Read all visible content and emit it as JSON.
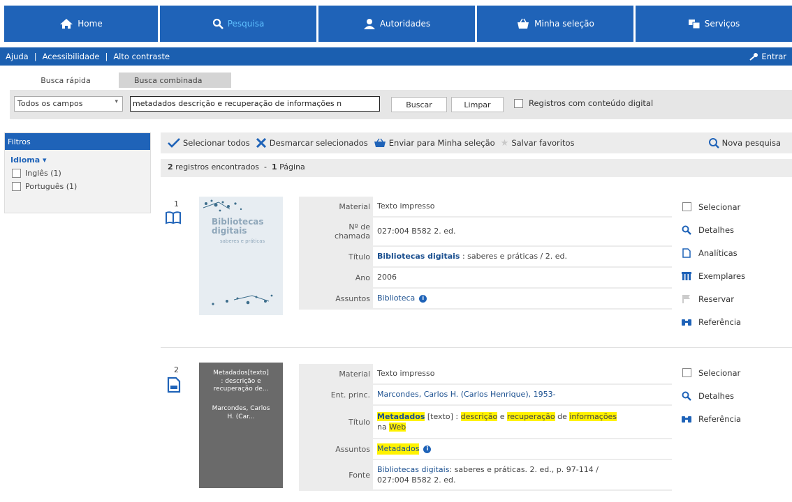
{
  "nav": {
    "home": "Home",
    "pesquisa": "Pesquisa",
    "autoridades": "Autoridades",
    "minha_selecao": "Minha seleção",
    "servicos": "Serviços"
  },
  "subnav": {
    "ajuda": "Ajuda",
    "acessibilidade": "Acessibilidade",
    "alto_contraste": "Alto contraste",
    "entrar": "Entrar"
  },
  "search": {
    "tab_rapida": "Busca rápida",
    "tab_combinada": "Busca combinada",
    "field_select": "Todos os campos",
    "query": "metadados descrição e recuperação de informações n",
    "buscar": "Buscar",
    "limpar": "Limpar",
    "digital_label": "Registros com conteúdo digital"
  },
  "filters": {
    "title": "Filtros",
    "group": "Idioma",
    "options": [
      "Inglês (1)",
      "Português (1)"
    ]
  },
  "toolbar": {
    "select_all": "Selecionar todos",
    "deselect": "Desmarcar selecionados",
    "send": "Enviar para Minha seleção",
    "save_fav": "Salvar favoritos",
    "new_search": "Nova pesquisa"
  },
  "results": {
    "count": "2",
    "count_text": " registros encontrados  -  ",
    "pages": "1",
    "pages_text": " Página"
  },
  "records": [
    {
      "num": "1",
      "material_label": "Material",
      "material": "Texto impresso",
      "chamada_label1": "Nº de",
      "chamada_label2": "chamada",
      "chamada": "027:004 B582 2. ed.",
      "titulo_label": "Título",
      "titulo_bold": "Bibliotecas digitais",
      "titulo_rest": " : saberes e práticas / 2. ed.",
      "ano_label": "Ano",
      "ano": "2006",
      "assuntos_label": "Assuntos",
      "assuntos": "Biblioteca",
      "cover_title": "Bibliotecas digitais",
      "cover_sub": "saberes e práticas",
      "actions": [
        "Selecionar",
        "Detalhes",
        "Analíticas",
        "Exemplares",
        "Reservar",
        "Referência"
      ]
    },
    {
      "num": "2",
      "material_label": "Material",
      "material": "Texto impresso",
      "ent_label": "Ent. princ.",
      "ent": "Marcondes, Carlos H. (Carlos Henrique), 1953-",
      "titulo_label": "Título",
      "t_metadados": "Metadados",
      "t_texto": " [texto] : ",
      "t_descricao": "descrição",
      "t_e": " e ",
      "t_recuperacao": "recuperação",
      "t_de": " de ",
      "t_informacoes": "informações",
      "t_na": "na ",
      "t_web": "Web",
      "assuntos_label": "Assuntos",
      "assuntos": "Metadados",
      "fonte_label": "Fonte",
      "fonte_link": "Bibliotecas digitais",
      "fonte_rest": ": saberes e práticas. 2. ed., p. 97-114 /",
      "fonte_line2": "027:004 B582 2. ed.",
      "cover_line1": "Metadados[texto]",
      "cover_line2": ": descrição e",
      "cover_line3": "recuperação de...",
      "cover_line4": "Marcondes, Carlos",
      "cover_line5": "H. (Car...",
      "actions": [
        "Selecionar",
        "Detalhes",
        "Referência"
      ]
    }
  ],
  "colors": {
    "primary": "#1f63b8",
    "highlight": "#fff200",
    "panel": "#ececec"
  }
}
